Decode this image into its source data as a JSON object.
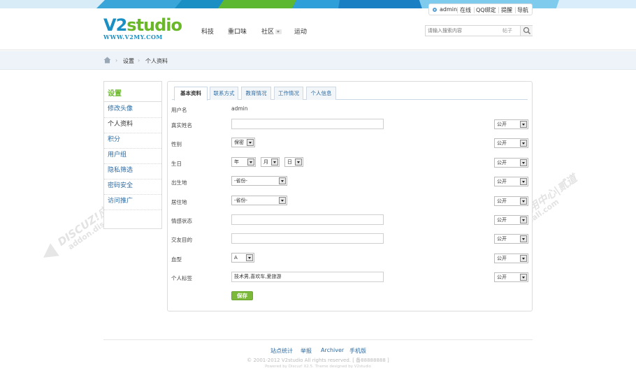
{
  "header": {
    "logo_main": "V2studio",
    "logo_sub": "WWW.V2MY.COM",
    "nav": [
      "科技",
      "重口味",
      "社区",
      "运动"
    ],
    "userbar": [
      "admin",
      "在线",
      "QQ绑定",
      "提醒",
      "导航"
    ],
    "search_placeholder": "请输入搜索内容",
    "search_scope": "帖子"
  },
  "breadcrumb": [
    "设置",
    "个人资料"
  ],
  "sidebar": {
    "title": "设置",
    "items": [
      "修改头像",
      "个人资料",
      "积分",
      "用户组",
      "隐私筛选",
      "密码安全",
      "访问推广"
    ],
    "active": "个人资料"
  },
  "tabs": [
    "基本资料",
    "联系方式",
    "教育情况",
    "工作情况",
    "个人信息"
  ],
  "form": {
    "username_label": "用户名",
    "username_value": "admin",
    "realname_label": "真实姓名",
    "gender_label": "性别",
    "gender_value": "保密",
    "birthday_label": "生日",
    "birth_year": "年",
    "birth_month": "月",
    "birth_day": "日",
    "birthplace_label": "出生地",
    "birthplace_value": "-省份-",
    "residence_label": "居住地",
    "residence_value": "-省份-",
    "affective_label": "情感状态",
    "lookingfor_label": "交友目的",
    "bloodtype_label": "血型",
    "bloodtype_value": "A",
    "tags_label": "个人标签",
    "tags_value": "技术男,喜欢车,爱旅游",
    "privacy_value": "公开",
    "save_label": "保存"
  },
  "footer": {
    "links": [
      "站点统计",
      "举报",
      "Archiver",
      "手机版"
    ],
    "copyright": "© 2001-2012 V2studio All rights reserved. [ 备88888888 ]",
    "powered": "Powered by Discuz! X2.5. Theme designed by V2studio"
  },
  "watermark": {
    "line1": "DISCUZ!应用中心|贰道",
    "line2": "addon.dismall.com"
  },
  "colors": {
    "accent_green": "#6ab82a",
    "link_blue": "#2e6aa0",
    "save_green": "#7cb93a"
  }
}
